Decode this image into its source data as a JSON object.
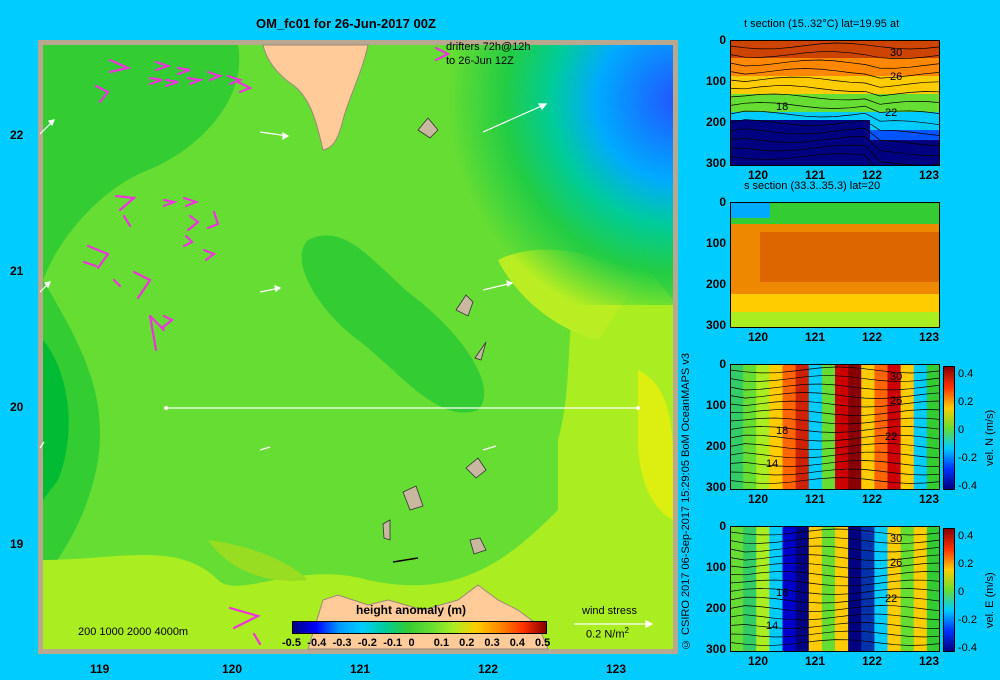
{
  "main_map": {
    "title": "OM_fc01 for 26-Jun-2017 00Z",
    "drifters_label_1": "drifters 72h@12h",
    "drifters_label_2": "to 26-Jun 12Z",
    "x_ticks": [
      "119",
      "120",
      "121",
      "122",
      "123"
    ],
    "y_ticks": [
      "22",
      "21",
      "20",
      "19"
    ],
    "depth_legend": "200  1000  2000  4000m",
    "colorbar_title": "height anomaly (m)",
    "colorbar_ticks": [
      "-0.5",
      "-0.4",
      "-0.3",
      "-0.2",
      "-0.1",
      "0",
      "0.1",
      "0.2",
      "0.3",
      "0.4",
      "0.5"
    ],
    "wind_stress_label": "wind stress",
    "wind_stress_unit": "0.2 N/m",
    "wind_stress_unit_sup": "2",
    "section_line_lat": "20"
  },
  "credit": "© CSIRO 2017   06-Sep-2017 15:29:05 BoM OceanMAPS v3",
  "panels": [
    {
      "title": "t section (15..32°C) lat=19.95 at",
      "x_ticks": [
        "120",
        "121",
        "122",
        "123"
      ],
      "y_ticks": [
        "0",
        "100",
        "200",
        "300"
      ],
      "contour_labels": [
        "30",
        "26",
        "22",
        "18"
      ]
    },
    {
      "title": "s section (33.3..35.3) lat=20",
      "x_ticks": [
        "120",
        "121",
        "122",
        "123"
      ],
      "y_ticks": [
        "0",
        "100",
        "200",
        "300"
      ]
    },
    {
      "title": "",
      "x_ticks": [
        "120",
        "121",
        "122",
        "123"
      ],
      "y_ticks": [
        "0",
        "100",
        "200",
        "300"
      ],
      "contour_labels": [
        "30",
        "26",
        "22",
        "18",
        "14"
      ],
      "colorbar_label": "vel. N (m/s)",
      "colorbar_ticks": [
        "0.4",
        "0.2",
        "0",
        "-0.2",
        "-0.4"
      ]
    },
    {
      "title": "",
      "x_ticks": [
        "120",
        "121",
        "122",
        "123"
      ],
      "y_ticks": [
        "0",
        "100",
        "200",
        "300"
      ],
      "contour_labels": [
        "30",
        "26",
        "22",
        "18",
        "14"
      ],
      "colorbar_label": "vel. E (m/s)",
      "colorbar_ticks": [
        "0.4",
        "0.2",
        "0",
        "-0.2",
        "-0.4"
      ]
    }
  ],
  "colors": {
    "background": "#00ccff",
    "ocean_green": "#66dd33",
    "land": "#ffcc99",
    "drifters": "#ee33dd",
    "frame": "#b8a890"
  }
}
